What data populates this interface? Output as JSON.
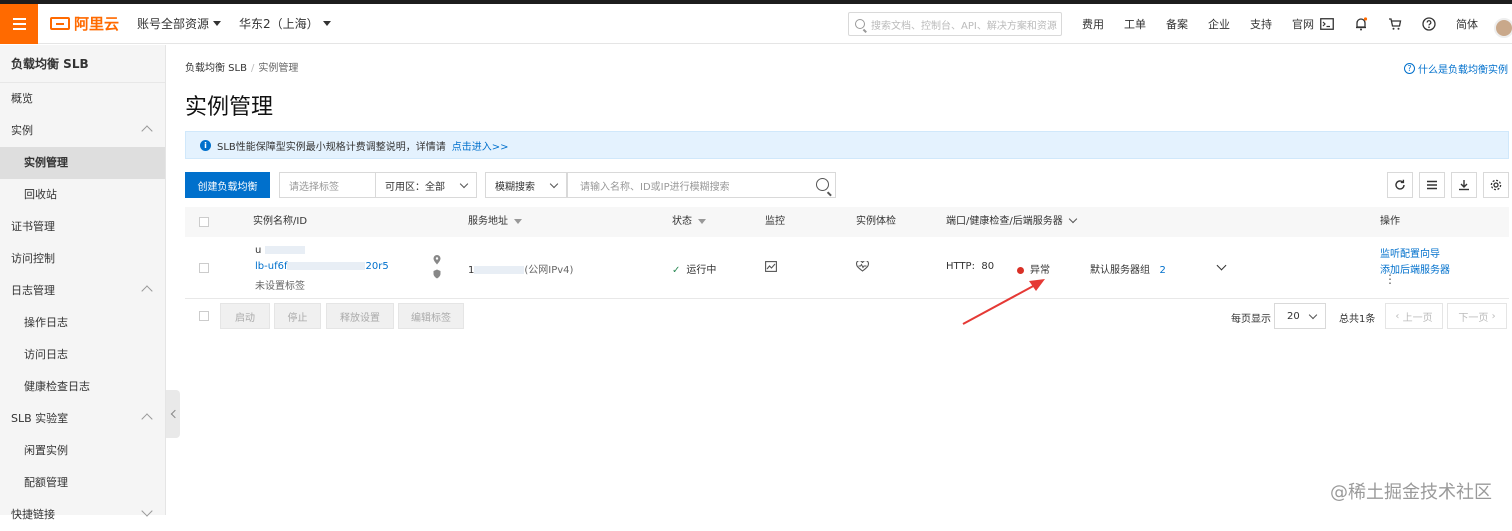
{
  "topbar": {
    "logo_text": "阿里云",
    "account_scope": "账号全部资源",
    "region": "华东2（上海）",
    "search_placeholder": "搜索文档、控制台、API、解决方案和资源",
    "links": [
      "费用",
      "工单",
      "备案",
      "企业",
      "支持",
      "官网"
    ],
    "lang": "简体",
    "colors": {
      "brand": "#ff6a00"
    }
  },
  "sidebar": {
    "title": "负载均衡 SLB",
    "items": [
      {
        "label": "概览",
        "level": 0
      },
      {
        "label": "实例",
        "level": 0,
        "expanded": true
      },
      {
        "label": "实例管理",
        "level": 1,
        "active": true
      },
      {
        "label": "回收站",
        "level": 1
      },
      {
        "label": "证书管理",
        "level": 0
      },
      {
        "label": "访问控制",
        "level": 0
      },
      {
        "label": "日志管理",
        "level": 0,
        "expanded": true
      },
      {
        "label": "操作日志",
        "level": 1
      },
      {
        "label": "访问日志",
        "level": 1
      },
      {
        "label": "健康检查日志",
        "level": 1
      },
      {
        "label": "SLB 实验室",
        "level": 0,
        "expanded": true
      },
      {
        "label": "闲置实例",
        "level": 1
      },
      {
        "label": "配额管理",
        "level": 1
      },
      {
        "label": "快捷链接",
        "level": 0
      }
    ]
  },
  "main": {
    "breadcrumb": [
      "负载均衡 SLB",
      "实例管理"
    ],
    "help_link": "什么是负载均衡实例",
    "title": "实例管理",
    "notice": {
      "text": "SLB性能保障型实例最小规格计费调整说明，详情请",
      "link": "点击进入>>"
    },
    "toolbar": {
      "create_button": "创建负载均衡",
      "tag_select_placeholder": "请选择标签",
      "zone_label": "可用区：",
      "zone_value": "全部",
      "search_mode": "模糊搜索",
      "search_placeholder": "请输入名称、ID或IP进行模糊搜索"
    },
    "table": {
      "headers": {
        "name": "实例名称/ID",
        "address": "服务地址",
        "status": "状态",
        "monitor": "监控",
        "checkup": "实例体检",
        "ports": "端口/健康检查/后端服务器",
        "actions": "操作"
      },
      "rows": [
        {
          "name_prefix": "u",
          "id_prefix": "lb-uf6f",
          "id_suffix": "20r5",
          "tag": "未设置标签",
          "address_prefix": "1",
          "address_suffix": "(公网IPv4)",
          "status": "运行中",
          "protocol": "HTTP:",
          "port": "80",
          "health": "异常",
          "server_group": "默认服务器组",
          "server_count": "2",
          "actions": [
            "监听配置向导",
            "添加后端服务器"
          ]
        }
      ]
    },
    "bulk_actions": [
      "启动",
      "停止",
      "释放设置",
      "编辑标签"
    ],
    "pager": {
      "per_page_label": "每页显示",
      "per_page_value": "20",
      "total": "总共1条",
      "prev": "上一页",
      "next": "下一页"
    },
    "colors": {
      "primary": "#0070cc",
      "error": "#d93026",
      "ok": "#2e8b57",
      "annotation_arrow": "#e53935"
    }
  },
  "watermark": "@稀土掘金技术社区"
}
